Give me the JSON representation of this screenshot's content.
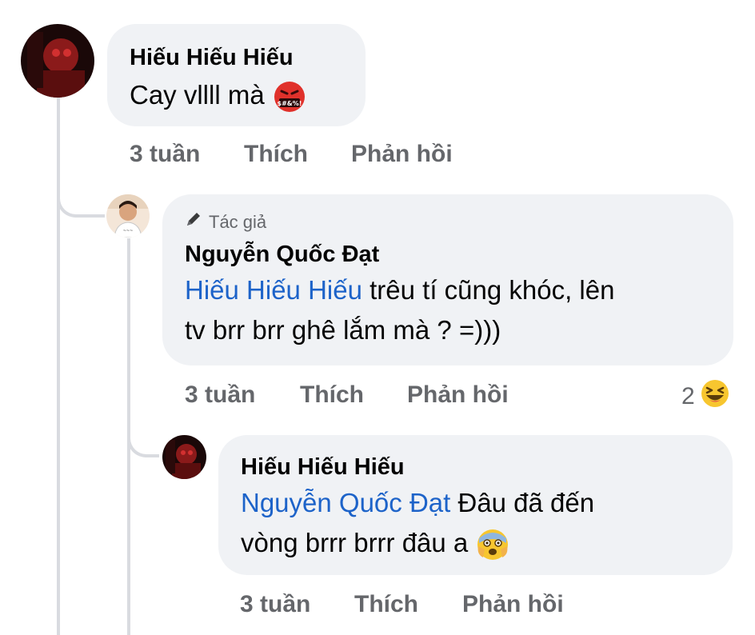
{
  "comments": [
    {
      "author": "Hiếu Hiếu Hiếu",
      "text": "Cay vllll mà",
      "emoji": "swearing-face-emoji",
      "time": "3 tuần",
      "like_label": "Thích",
      "reply_label": "Phản hồi"
    },
    {
      "badge": "Tác giả",
      "author": "Nguyễn Quốc Đạt",
      "mention": "Hiếu Hiếu Hiếu",
      "text_line1": " trêu tí cũng khóc, lên",
      "text_line2": "tv brr brr ghê lắm mà ? =)))",
      "time": "3 tuần",
      "like_label": "Thích",
      "reply_label": "Phản hồi",
      "reaction_count": "2",
      "reaction": "laughing-face-emoji"
    },
    {
      "author": "Hiếu Hiếu Hiếu",
      "mention": "Nguyễn Quốc Đạt",
      "text_line1": " Đâu đã đến",
      "text_line2": "vòng brrr brrr đâu a",
      "emoji": "fearful-face-emoji",
      "time": "3 tuần",
      "like_label": "Thích",
      "reply_label": "Phản hồi"
    }
  ],
  "colors": {
    "bubble": "#f0f2f5",
    "mention": "#1d63c9",
    "meta": "#65676b",
    "thread_line": "#d9dbe0"
  }
}
